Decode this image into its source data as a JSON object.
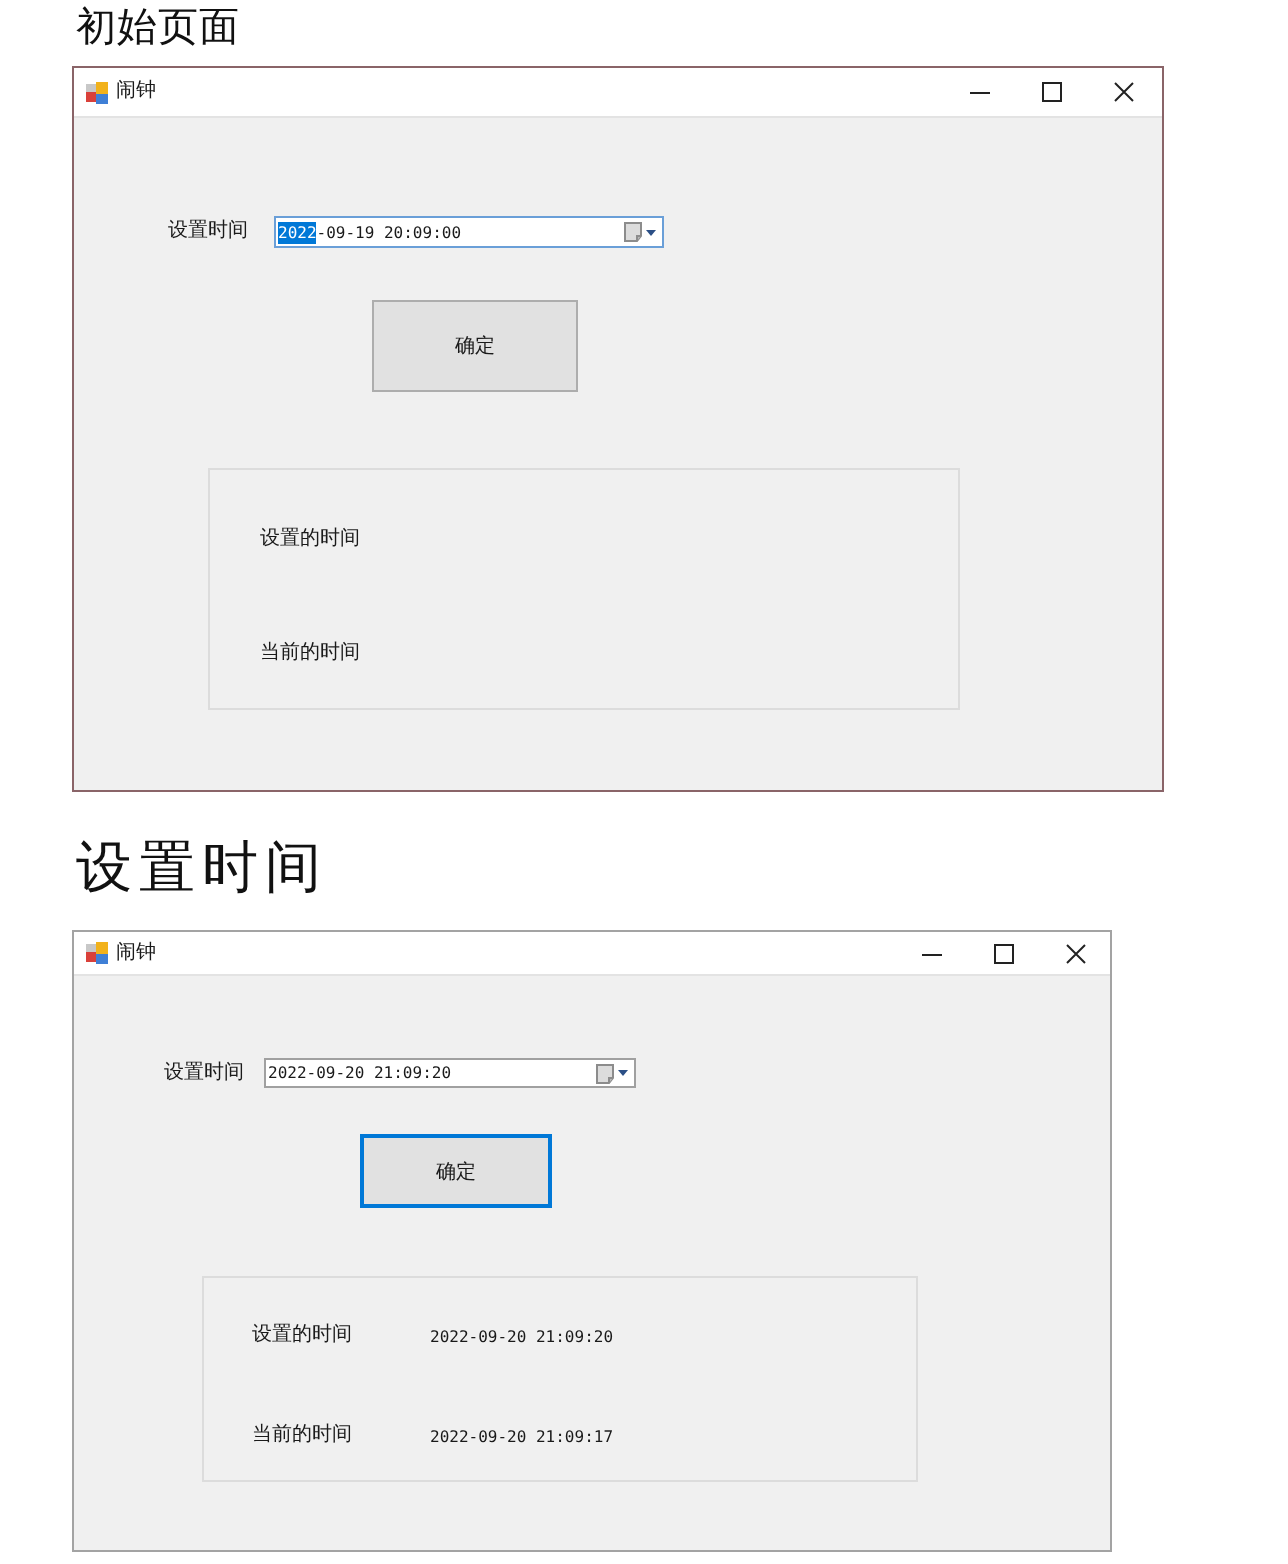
{
  "sections": [
    {
      "heading": "初始页面",
      "window": {
        "title": "闹钟",
        "active": true,
        "picker": {
          "label": "设置时间",
          "focused": true,
          "value_parts": [
            {
              "text": "2022",
              "selected": true
            },
            {
              "text": "-09-19 20:09:00",
              "selected": false
            }
          ]
        },
        "button": {
          "label": "确定",
          "focused": false
        },
        "group": {
          "rows": [
            {
              "label": "设置的时间"
            },
            {
              "label": "当前的时间"
            }
          ]
        }
      }
    },
    {
      "heading": "设置时间",
      "window": {
        "title": "闹钟",
        "active": false,
        "picker": {
          "label": "设置时间",
          "focused": false,
          "value_parts": [
            {
              "text": "2022-09-20 21:09:20",
              "selected": false
            }
          ]
        },
        "button": {
          "label": "确定",
          "focused": true
        },
        "group": {
          "rows": [
            {
              "label": "设置的时间",
              "value": "2022-09-20 21:09:20"
            },
            {
              "label": "当前的时间",
              "value": "2022-09-20 21:09:17"
            }
          ]
        }
      }
    }
  ]
}
